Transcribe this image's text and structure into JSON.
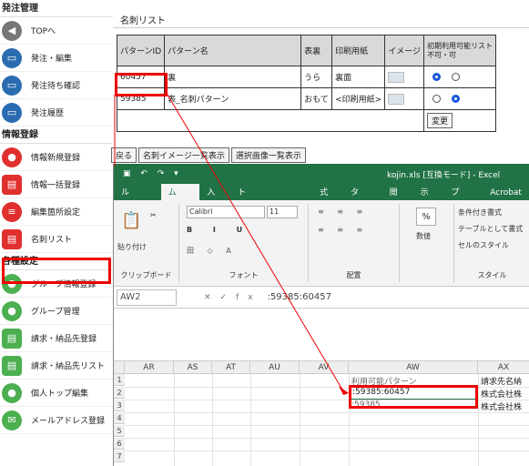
{
  "sidebar": {
    "section1": "発注管理",
    "items1": [
      {
        "label": "TOPへ",
        "icon": "home-icon"
      },
      {
        "label": "発注・編集",
        "icon": "cart-icon"
      },
      {
        "label": "発注待ち確認",
        "icon": "cart-wait-icon"
      },
      {
        "label": "発注履歴",
        "icon": "cart-history-icon"
      }
    ],
    "section2": "情報登録",
    "items2": [
      {
        "label": "情報新規登録",
        "icon": "person-add-icon"
      },
      {
        "label": "情報一括登録",
        "icon": "bulk-icon"
      },
      {
        "label": "編集箇所設定",
        "icon": "list-edit-icon"
      },
      {
        "label": "名刺リスト",
        "icon": "card-list-icon"
      }
    ],
    "section3": "各種設定",
    "items3": [
      {
        "label": "グループ情報登録",
        "icon": "group-add-icon"
      },
      {
        "label": "グループ管理",
        "icon": "group-icon"
      },
      {
        "label": "請求・納品先登録",
        "icon": "invoice-add-icon"
      },
      {
        "label": "請求・納品先リスト",
        "icon": "invoice-list-icon"
      },
      {
        "label": "個人トップ編集",
        "icon": "person-edit-icon"
      },
      {
        "label": "メールアドレス登録",
        "icon": "mail-icon"
      }
    ]
  },
  "main": {
    "title": "名刺リスト",
    "table": {
      "headers": [
        "パターンID",
        "パターン名",
        "表裏",
        "印刷用紙",
        "イメージ",
        "初期利用可能リスト",
        "不可・可"
      ],
      "rows": [
        [
          "60457",
          "裏",
          "うら",
          "裏面"
        ],
        [
          "59385",
          "表_名刺パターン",
          "おもて",
          "<印刷用紙>"
        ]
      ],
      "change_btn": "変更"
    },
    "buttons": [
      "戻る",
      "名刺イメージ一覧表示",
      "選択画像一覧表示"
    ]
  },
  "excel": {
    "title": "kojin.xls [互換モード] - Excel",
    "tabs": [
      "ファイル",
      "ホーム",
      "挿入",
      "ページ レイアウト",
      "数式",
      "データ",
      "校閲",
      "表示",
      "ヘルプ",
      "Acrobat"
    ],
    "ribbon": {
      "paste": "貼り付け",
      "clipboard": "クリップボード",
      "font_name": "Calibri",
      "font_size": "11",
      "font": "フォント",
      "align": "配置",
      "number": "数値",
      "percent": "%",
      "cond1": "条件付き書式",
      "cond2": "テーブルとして書式",
      "cond3": "セルのスタイル",
      "style": "スタイル"
    },
    "namebox": "AW2",
    "formula": ":59385:60457",
    "columns": [
      "AR",
      "AS",
      "AT",
      "AU",
      "AV",
      "AW",
      "AX"
    ],
    "rows": [
      "1",
      "2",
      "3",
      "4",
      "5",
      "6",
      "7"
    ],
    "cells": {
      "aw1": "利用可能パターン",
      "aw2": ":59385:60457",
      "aw3": ":59385",
      "ax1": "請求先名納",
      "ax2": "株式会社株",
      "ax3": "株式会社株"
    }
  }
}
